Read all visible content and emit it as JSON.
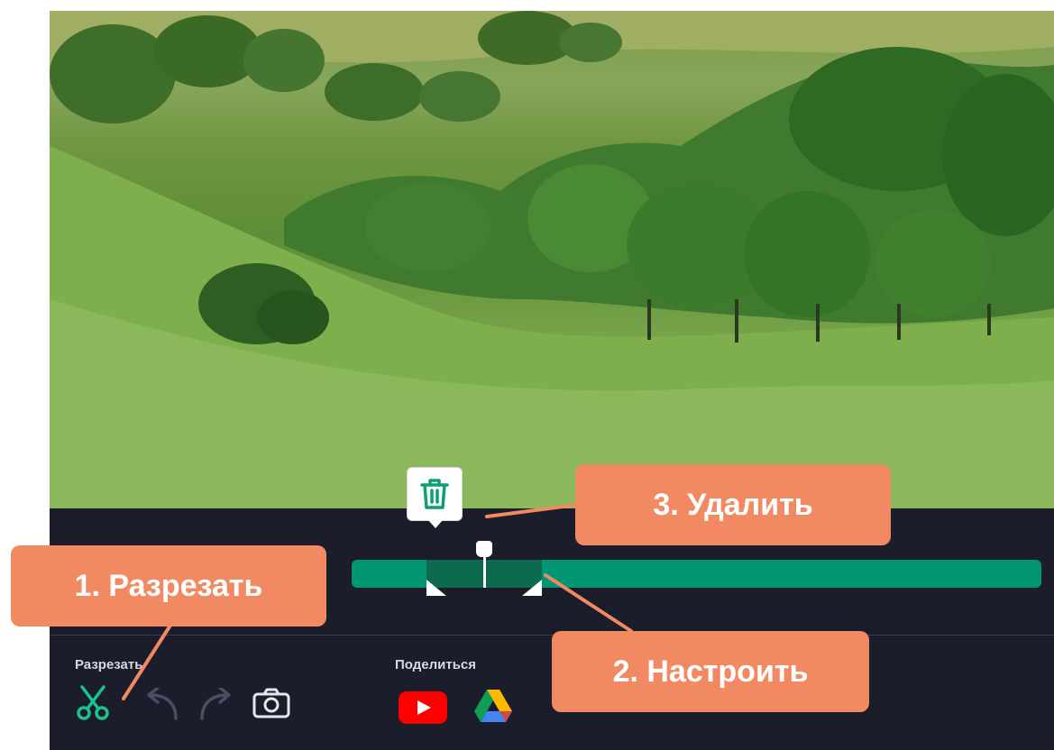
{
  "toolbar": {
    "cut_group_label": "Разрезать",
    "share_group_label": "Поделиться"
  },
  "icons": {
    "cut": "scissors-icon",
    "undo": "undo-icon",
    "redo": "redo-icon",
    "snapshot": "camera-icon",
    "youtube": "youtube-icon",
    "google_drive": "google-drive-icon",
    "delete": "trash-icon"
  },
  "callouts": {
    "cut": "1. Разрезать",
    "adjust": "2. Настроить",
    "delete": "3. Удалить"
  },
  "colors": {
    "accent": "#009674",
    "accent_dark": "#0c6a4f",
    "panel": "#1c1d2b",
    "callout": "#f18a63"
  }
}
